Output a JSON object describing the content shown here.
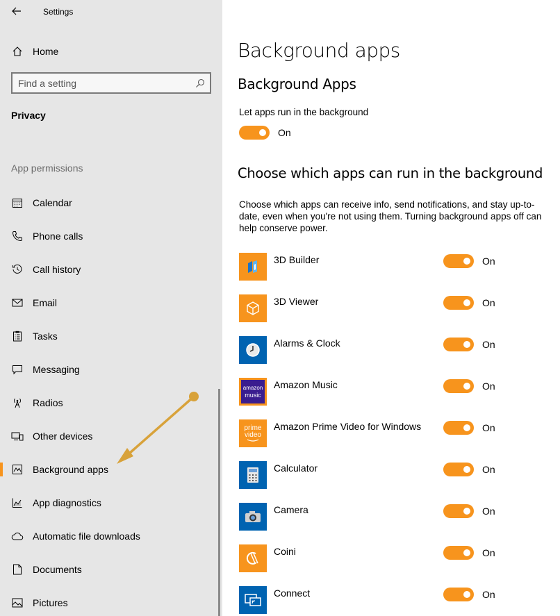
{
  "window": {
    "title": "Settings"
  },
  "sidebar": {
    "home_label": "Home",
    "search": {
      "placeholder": "Find a setting"
    },
    "section_title": "Privacy",
    "group_title": "App permissions",
    "items": [
      {
        "label": "Calendar",
        "icon": "calendar-icon"
      },
      {
        "label": "Phone calls",
        "icon": "phone-icon"
      },
      {
        "label": "Call history",
        "icon": "history-icon"
      },
      {
        "label": "Email",
        "icon": "email-icon"
      },
      {
        "label": "Tasks",
        "icon": "tasks-icon"
      },
      {
        "label": "Messaging",
        "icon": "messaging-icon"
      },
      {
        "label": "Radios",
        "icon": "radio-icon"
      },
      {
        "label": "Other devices",
        "icon": "devices-icon"
      },
      {
        "label": "Background apps",
        "icon": "background-apps-icon",
        "active": true
      },
      {
        "label": "App diagnostics",
        "icon": "diagnostics-icon"
      },
      {
        "label": "Automatic file downloads",
        "icon": "cloud-icon"
      },
      {
        "label": "Documents",
        "icon": "document-icon"
      },
      {
        "label": "Pictures",
        "icon": "pictures-icon"
      }
    ],
    "accent_color": "#f7941d"
  },
  "main": {
    "page_title": "Background apps",
    "subtitle": "Background Apps",
    "master_toggle": {
      "description": "Let apps run in the background",
      "state": "On"
    },
    "choose_title": "Choose which apps can run in the background",
    "choose_description": "Choose which apps can receive info, send notifications, and stay up-to-date, even when you're not using them. Turning background apps off can help conserve power.",
    "apps": [
      {
        "name": "3D Builder",
        "state": "On",
        "icon_color": "#f7941d"
      },
      {
        "name": "3D Viewer",
        "state": "On",
        "icon_color": "#f7941d"
      },
      {
        "name": "Alarms & Clock",
        "state": "On",
        "icon_color": "#0063b1"
      },
      {
        "name": "Amazon Music",
        "state": "On",
        "icon_color": "#f7941d",
        "icon_text": "amazon music"
      },
      {
        "name": "Amazon Prime Video for Windows",
        "state": "On",
        "icon_color": "#f7941d",
        "icon_text": "prime video"
      },
      {
        "name": "Calculator",
        "state": "On",
        "icon_color": "#0063b1"
      },
      {
        "name": "Camera",
        "state": "On",
        "icon_color": "#0063b1"
      },
      {
        "name": "Coini",
        "state": "On",
        "icon_color": "#f7941d"
      },
      {
        "name": "Connect",
        "state": "On",
        "icon_color": "#0063b1"
      }
    ],
    "toggle_color": "#f7941d"
  }
}
